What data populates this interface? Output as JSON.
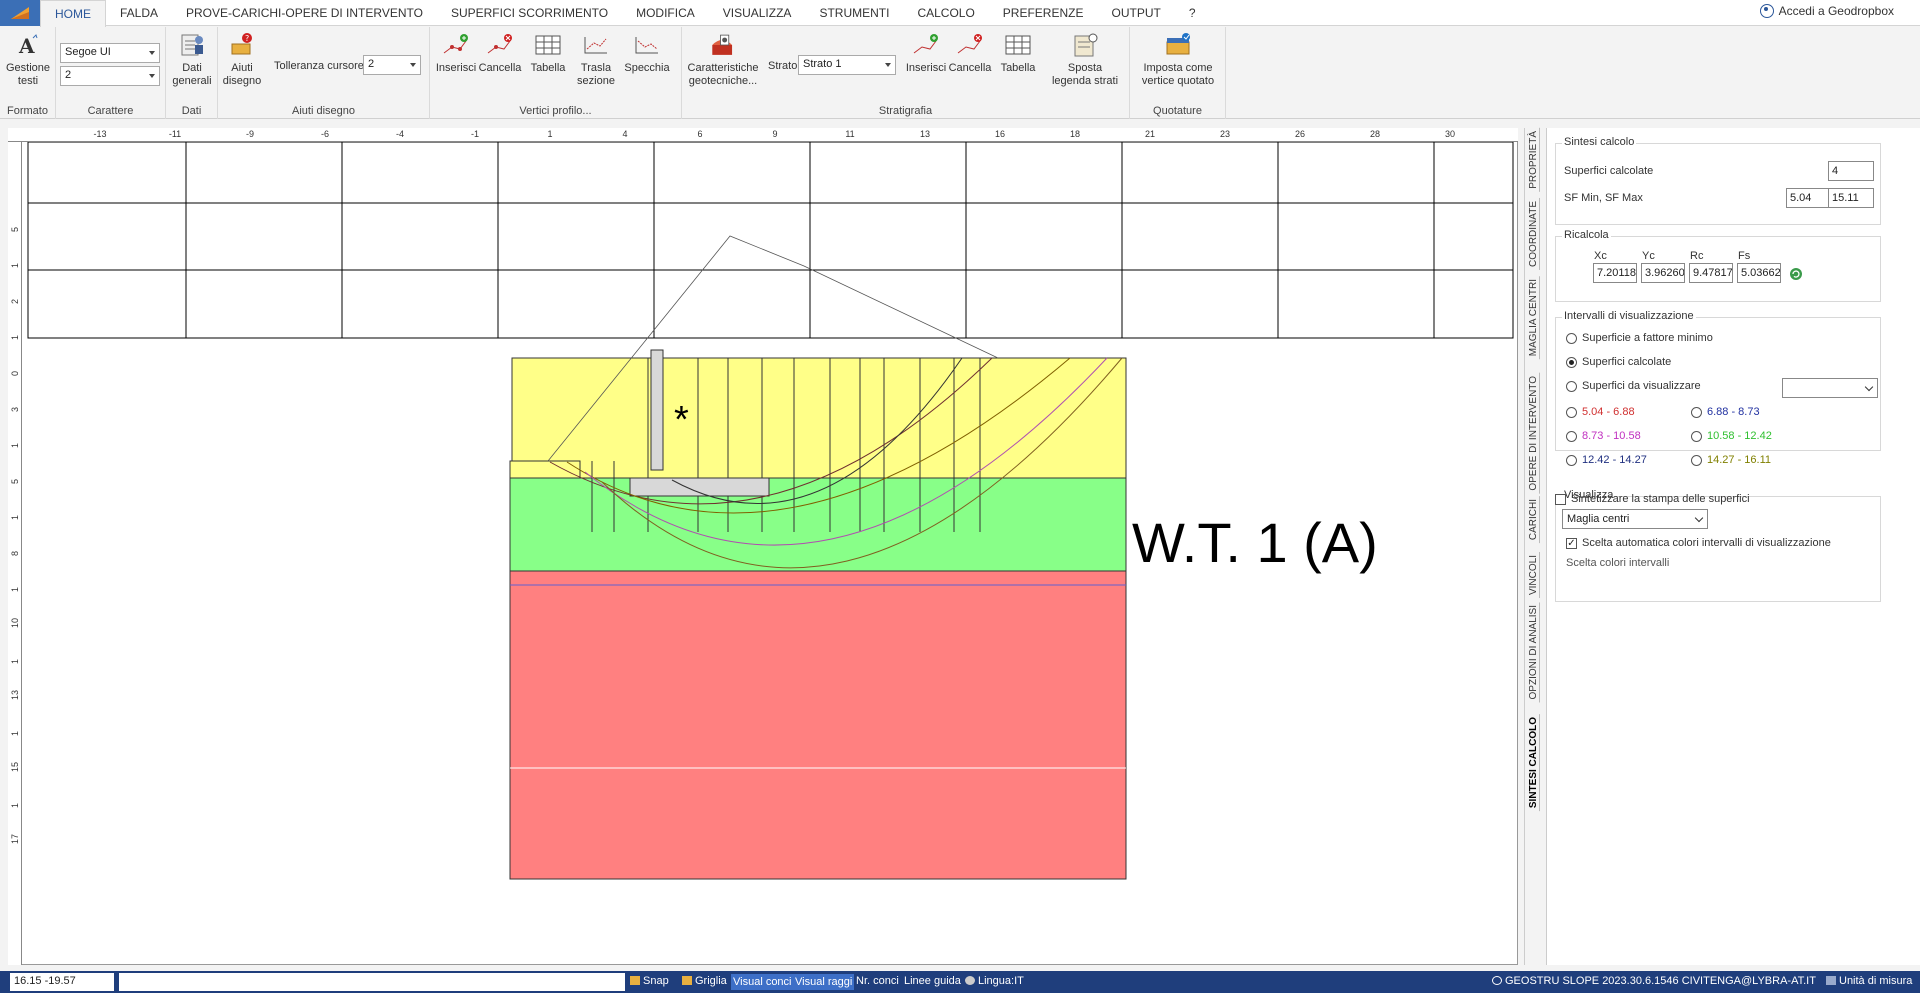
{
  "menu": {
    "tabs": [
      "HOME",
      "FALDA",
      "PROVE-CARICHI-OPERE DI INTERVENTO",
      "SUPERFICI SCORRIMENTO",
      "MODIFICA",
      "VISUALIZZA",
      "STRUMENTI",
      "CALCOLO",
      "PREFERENZE",
      "OUTPUT",
      "?"
    ],
    "active_tab": "HOME",
    "account_label": "Accedi a Geodropbox"
  },
  "ribbon": {
    "formato": {
      "label": "Formato",
      "gestione_testi": [
        "Gestione",
        "testi"
      ]
    },
    "carattere": {
      "label": "Carattere",
      "font_name": "Segoe UI",
      "font_size": "2"
    },
    "dati": {
      "label": "Dati",
      "dati_generali": [
        "Dati",
        "generali"
      ]
    },
    "aiuti_disegno": {
      "label": "Aiuti disegno",
      "aiuti_btn": [
        "Aiuti",
        "disegno"
      ],
      "tolleranza_label": "Tolleranza cursore",
      "tolleranza_value": "2"
    },
    "vertici_profilo": {
      "label": "Vertici profilo...",
      "inserisci": "Inserisci",
      "cancella": "Cancella",
      "tabella": "Tabella",
      "trasla": [
        "Trasla",
        "sezione"
      ],
      "specchia": "Specchia"
    },
    "stratigrafia": {
      "label": "Stratigrafia",
      "caratteristiche": [
        "Caratteristiche",
        "geotecniche..."
      ],
      "strato_label": "Strato",
      "strato_value": "Strato 1",
      "inserisci": "Inserisci",
      "cancella": "Cancella",
      "tabella": "Tabella",
      "sposta": [
        "Sposta",
        "legenda strati"
      ]
    },
    "quotature": {
      "label": "Quotature",
      "imposta": [
        "Imposta come",
        "vertice quotato"
      ]
    }
  },
  "rulers": {
    "h_ticks": [
      "-13",
      "-11",
      "-9",
      "-6",
      "-4",
      "-1",
      "1",
      "4",
      "6",
      "9",
      "11",
      "13",
      "16",
      "18",
      "21",
      "23",
      "26",
      "28",
      "30"
    ],
    "v_ticks": [
      "5",
      "1",
      "2",
      "1",
      "0",
      "3",
      "1",
      "5",
      "1",
      "8",
      "1",
      "10",
      "1",
      "13",
      "1",
      "15",
      "1",
      "17"
    ]
  },
  "drawing": {
    "asterisk": "*",
    "wt_label": "W.T. 1 (A)",
    "layer_colors": {
      "top": "#ffff88",
      "middle": "#88ff88",
      "bottom": "#ff8080",
      "wall": "#d8d8d8"
    }
  },
  "side_tabs": [
    "PROPRIETÀ",
    "COORDINATE",
    "MAGLIA CENTRI",
    "OPERE DI INTERVENTO",
    "CARICHI",
    "VINCOLI",
    "OPZIONI DI ANALISI",
    "SINTESI CALCOLO"
  ],
  "panel": {
    "sintesi": {
      "title": "Sintesi calcolo",
      "superfici_label": "Superfici calcolate",
      "superfici_value": "4",
      "sf_label": "SF Min, SF Max",
      "sf_min": "5.04",
      "sf_max": "15.11"
    },
    "ricalcola": {
      "title": "Ricalcola",
      "headers": [
        "Xc",
        "Yc",
        "Rc",
        "Fs"
      ],
      "values": [
        "7.20118",
        "3.96260",
        "9.47817",
        "5.03662"
      ]
    },
    "intervalli": {
      "title": "Intervalli di visualizzazione",
      "options": [
        "Superficie a fattore minimo",
        "Superfici calcolate",
        "Superfici da visualizzare"
      ],
      "selected": 1,
      "ranges": [
        {
          "label": "5.04 - 6.88",
          "color": "#d03030"
        },
        {
          "label": "6.88 - 8.73",
          "color": "#2030a0"
        },
        {
          "label": "8.73 - 10.58",
          "color": "#c030c0"
        },
        {
          "label": "10.58 - 12.42",
          "color": "#30c030"
        },
        {
          "label": "12.42 - 14.27",
          "color": "#203080"
        },
        {
          "label": "14.27 - 16.11",
          "color": "#808000"
        }
      ]
    },
    "visualizza": {
      "title": "Visualizza",
      "select_value": "Maglia centri",
      "auto_colors_label": "Scelta automatica colori intervalli di visualizzazione",
      "auto_colors_checked": true,
      "scelta_colori": "Scelta colori intervalli"
    },
    "sintetizzare_label": "Sintetizzare la stampa delle superfici",
    "sintetizzare_checked": false
  },
  "status": {
    "coords": "16.15  -19.57",
    "items": [
      "Snap",
      "Griglia",
      "Visual conci",
      "Visual raggi",
      "Nr. conci",
      "Linee guida",
      "Lingua:IT"
    ],
    "right_text": "GEOSTRU  SLOPE 2023.30.6.1546 CIVITENGA@LYBRA-AT.IT",
    "units": "Unità di misura"
  }
}
